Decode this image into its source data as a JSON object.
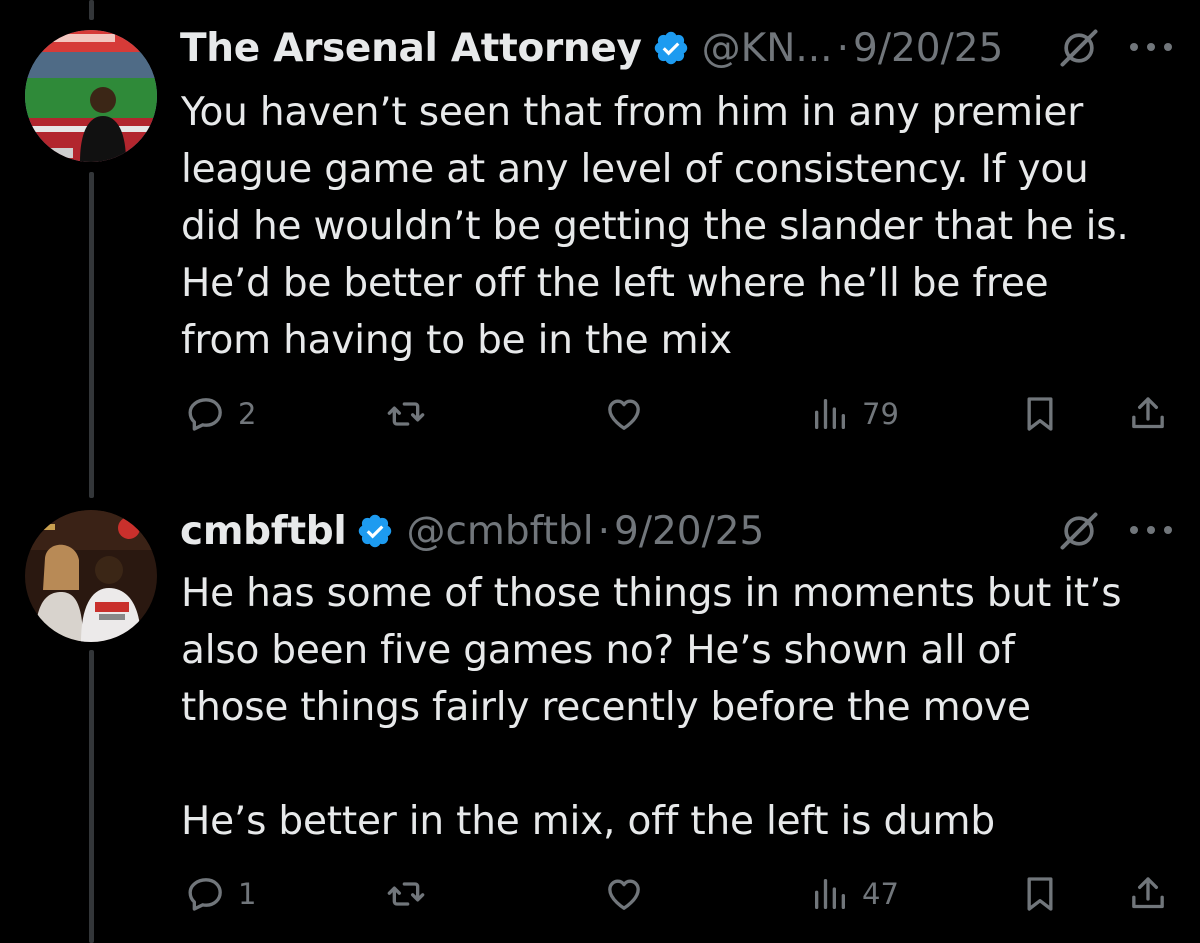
{
  "tweets": [
    {
      "author_name": "The Arsenal Attorney",
      "handle": "@KN...",
      "separator": "·",
      "date": "9/20/25",
      "body": "You haven’t seen that from him in any premier\nleague game at any level of consistency. If you\ndid he wouldn’t be getting the slander that he is.\nHe’d be better off the left where he’ll be free\nfrom having to be in the mix",
      "replies": "2",
      "views": "79"
    },
    {
      "author_name": "cmbftbl",
      "handle": "@cmbftbl",
      "separator": "·",
      "date": "9/20/25",
      "body": "He has some of those things in moments but it’s\nalso been five games no? He’s shown all of\nthose things fairly recently before the move\n\nHe’s better in the mix, off the left is dumb",
      "replies": "1",
      "views": "47"
    }
  ],
  "colors": {
    "background": "#000000",
    "text": "#e7e9ea",
    "secondary": "#71767b",
    "verified": "#1d9bf0",
    "thread_line": "#333639"
  },
  "icons": [
    "verified-badge-icon",
    "grok-icon",
    "more-icon",
    "reply-icon",
    "retweet-icon",
    "like-icon",
    "views-icon",
    "bookmark-icon",
    "share-icon"
  ]
}
